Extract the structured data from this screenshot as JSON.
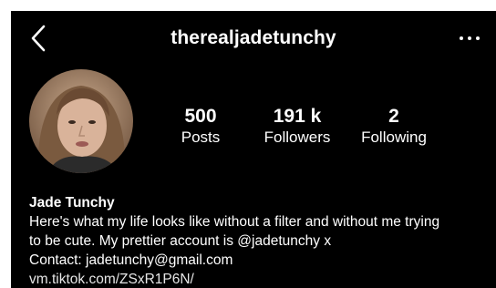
{
  "header": {
    "username": "therealjadetunchy",
    "back_icon": "chevron-left-icon",
    "more_icon": "more-horizontal-icon"
  },
  "profile": {
    "avatar_icon": "profile-photo",
    "stats": {
      "posts": {
        "value": "500",
        "label": "Posts"
      },
      "followers": {
        "value": "191 k",
        "label": "Followers"
      },
      "following": {
        "value": "2",
        "label": "Following"
      }
    }
  },
  "bio": {
    "name": "Jade Tunchy",
    "line1": "Here's what my life looks like without a filter and without me trying",
    "line2": "to be cute. My prettier account is @jadetunchy x",
    "line3": "Contact: jadetunchy@gmail.com",
    "link": "vm.tiktok.com/ZSxR1P6N/"
  },
  "colors": {
    "background": "#000000",
    "text": "#ffffff"
  }
}
